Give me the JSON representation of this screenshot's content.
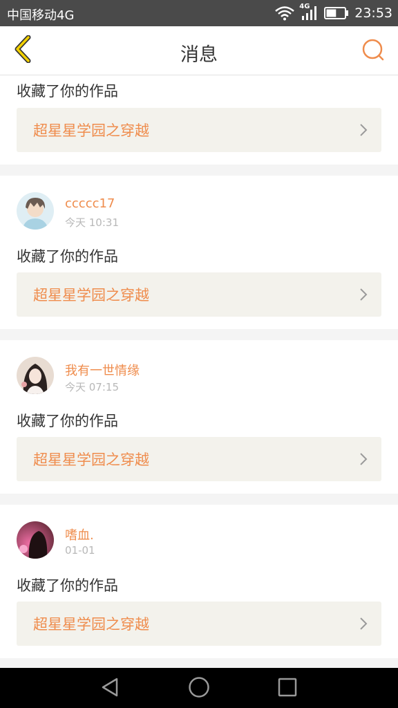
{
  "status_bar": {
    "carrier": "中国移动4G",
    "network_badge": "4G",
    "time": "23:53",
    "battery_level": 0.55,
    "icons": [
      "wifi-icon",
      "signal-icon",
      "battery-icon"
    ]
  },
  "header": {
    "title": "消息",
    "back_icon": "chevron-left-icon",
    "search_icon": "search-icon"
  },
  "colors": {
    "accent": "#ef8c4c",
    "back_accent": "#f2b800",
    "card_bg": "#ffffff",
    "page_bg": "#f4f4f4",
    "link_bg": "#f3f2ec"
  },
  "notifications": [
    {
      "username": "",
      "time": "",
      "action": "收藏了你的作品",
      "work_title": "超星星学园之穿越"
    },
    {
      "username": "ccccc17",
      "time": "今天 10:31",
      "action": "收藏了你的作品",
      "work_title": "超星星学园之穿越"
    },
    {
      "username": "我有一世情缘",
      "time": "今天 07:15",
      "action": "收藏了你的作品",
      "work_title": "超星星学园之穿越"
    },
    {
      "username": "嗜血.",
      "time": "01-01",
      "action": "收藏了你的作品",
      "work_title": "超星星学园之穿越"
    }
  ],
  "nav_bar": {
    "back_icon": "triangle-back-icon",
    "home_icon": "circle-home-icon",
    "recents_icon": "square-recents-icon"
  }
}
